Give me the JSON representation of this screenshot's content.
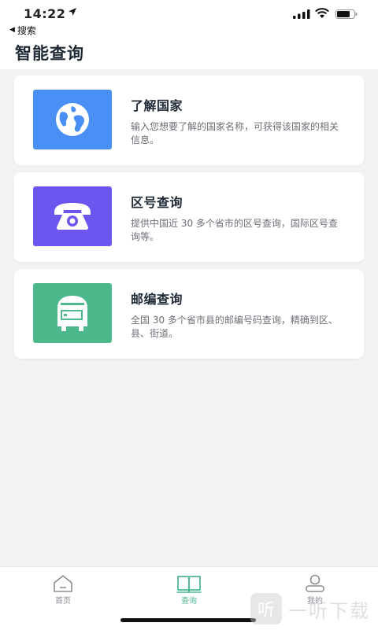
{
  "status_bar": {
    "time": "14:22"
  },
  "nav": {
    "back_label": "搜索",
    "title": "智能查询"
  },
  "cards": [
    {
      "title": "了解国家",
      "desc": "输入您想要了解的国家名称，可获得该国家的相关信息。",
      "color": "#4a8ff5",
      "icon": "globe-icon"
    },
    {
      "title": "区号查询",
      "desc": "提供中国近 30 多个省市的区号查询，国际区号查询等。",
      "color": "#6b57f0",
      "icon": "telephone-icon"
    },
    {
      "title": "邮编查询",
      "desc": "全国 30 多个省市县的邮编号码查询，精确到区、县、街道。",
      "color": "#4cb88c",
      "icon": "mailbox-icon"
    }
  ],
  "tabbar": {
    "tabs": [
      {
        "label": "首页",
        "icon": "home-icon",
        "active": false
      },
      {
        "label": "查询",
        "icon": "book-icon",
        "active": true
      },
      {
        "label": "我的",
        "icon": "user-icon",
        "active": false
      }
    ],
    "accent": "#4fb88f"
  },
  "watermark": {
    "text": "一听下载",
    "logo_char": "听"
  }
}
